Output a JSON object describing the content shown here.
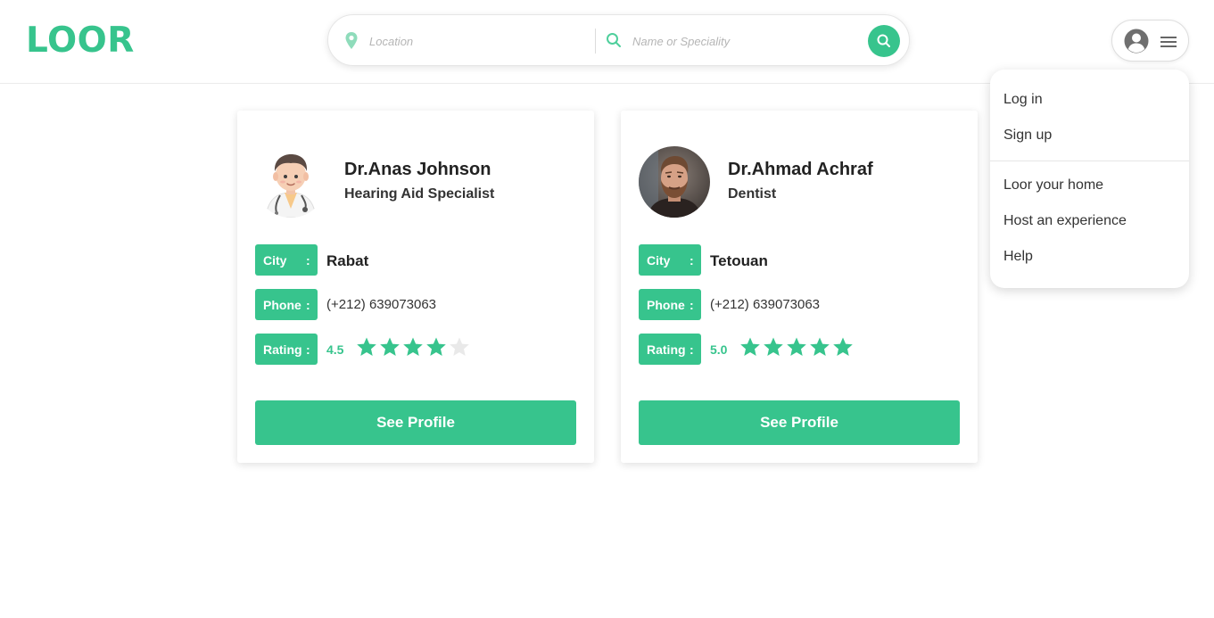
{
  "brand": {
    "logo_text": "LOOR",
    "accent_color": "#37c48d"
  },
  "search": {
    "location_placeholder": "Location",
    "location_icon": "location-pin-icon",
    "name_placeholder": "Name or Speciality",
    "name_icon": "search-icon",
    "submit_icon": "search-icon"
  },
  "user_menu": {
    "icons": [
      "user-avatar-icon",
      "hamburger-menu-icon"
    ],
    "items": [
      "Log in",
      "Sign up",
      "Loor your home",
      "Host an experience",
      "Help"
    ]
  },
  "doctors": [
    {
      "name": "Dr.Anas Johnson",
      "speciality": "Hearing Aid Specialist",
      "city_label": "City",
      "city": "Rabat",
      "phone_label": "Phone",
      "phone": "(+212) 639073063",
      "rating_label": "Rating",
      "rating": "4.5",
      "filled_stars": 4,
      "total_stars": 5,
      "button": "See Profile",
      "photo": "cartoon-doctor-avatar"
    },
    {
      "name": "Dr.Ahmad Achraf",
      "speciality": "Dentist",
      "city_label": "City",
      "city": "Tetouan",
      "phone_label": "Phone",
      "phone": "(+212) 639073063",
      "rating_label": "Rating",
      "rating": "5.0",
      "filled_stars": 5,
      "total_stars": 5,
      "button": "See Profile",
      "photo": "bearded-man-photo"
    }
  ],
  "colors": {
    "star_filled": "#37c48d",
    "star_empty": "#e9e9e9"
  }
}
